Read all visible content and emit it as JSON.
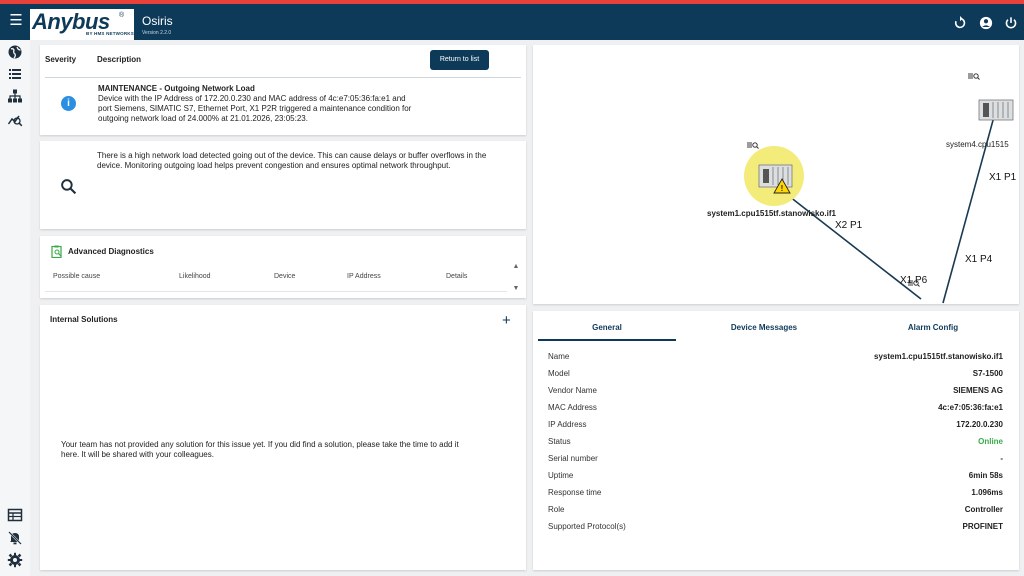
{
  "header": {
    "brand": "Anybus",
    "brand_reg": "®",
    "brand_sub": "BY HMS NETWORKS",
    "app_title": "Osiris",
    "version": "Version 2.2.0"
  },
  "event": {
    "severity_header": "Severity",
    "description_header": "Description",
    "return_label": "Return to list",
    "title": "MAINTENANCE - Outgoing Network Load",
    "lines": [
      "Device with the IP Address of 172.20.0.230 and MAC address of 4c:e7:05:36:fa:e1 and",
      "port Siemens, SIMATIC S7, Ethernet Port, X1 P2R triggered a maintenance condition for",
      "outgoing network load of 24.000% at 21.01.2026, 23:05:23."
    ]
  },
  "insight": {
    "lines": [
      "There is a high network load detected going out of the device. This can cause delays or buffer overflows in the",
      "device. Monitoring outgoing load helps prevent congestion and ensures optimal network throughput."
    ]
  },
  "diagnostics": {
    "title": "Advanced Diagnostics",
    "columns": [
      "Possible cause",
      "Likelihood",
      "Device",
      "IP Address",
      "Details"
    ]
  },
  "solutions": {
    "title": "Internal Solutions",
    "add": "+",
    "lines": [
      "Your team has not provided any solution for this issue yet. If you did find a solution, please take the time to add it",
      "here. It will be shared with your colleagues."
    ]
  },
  "topology": {
    "device1": "system1.cpu1515tf.stanowisko.if1",
    "device2": "system4.cpu1515",
    "ports": [
      "X2 P1",
      "X1 P6",
      "X1 P4",
      "X1 P1"
    ]
  },
  "tabs": [
    "General",
    "Device Messages",
    "Alarm Config"
  ],
  "props": [
    {
      "key": "Name",
      "value": "system1.cpu1515tf.stanowisko.if1"
    },
    {
      "key": "Model",
      "value": "S7-1500"
    },
    {
      "key": "Vendor Name",
      "value": "SIEMENS AG"
    },
    {
      "key": "MAC Address",
      "value": "4c:e7:05:36:fa:e1"
    },
    {
      "key": "IP Address",
      "value": "172.20.0.230"
    },
    {
      "key": "Status",
      "value": "Online"
    },
    {
      "key": "Serial number",
      "value": "-"
    },
    {
      "key": "Uptime",
      "value": "6min 58s"
    },
    {
      "key": "Response time",
      "value": "1.096ms"
    },
    {
      "key": "Role",
      "value": "Controller"
    },
    {
      "key": "Supported Protocol(s)",
      "value": "PROFINET"
    }
  ],
  "colors": {
    "primary": "#0e3a5a",
    "accent_stripe": "#e8413a",
    "online": "#3aa94a",
    "info": "#2a8fe0",
    "warning_halo": "#f3ec7a"
  },
  "icons": [
    "menu-icon",
    "globe-icon",
    "list-icon",
    "hierarchy-icon",
    "analytics-icon",
    "restart-icon",
    "account-icon",
    "power-icon",
    "info-icon",
    "search-icon",
    "diagnostics-icon",
    "table-icon",
    "alarm-off-icon",
    "settings-icon",
    "zoom-icon",
    "device-icon",
    "warning-icon",
    "scroll-up-icon",
    "scroll-down-icon"
  ]
}
